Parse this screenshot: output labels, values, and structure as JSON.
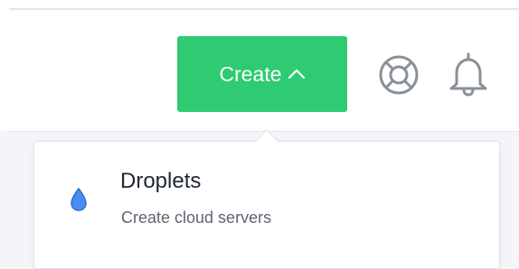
{
  "header": {
    "create_button": {
      "label": "Create",
      "color": "#2ecb72"
    },
    "icons": [
      {
        "name": "help-lifebuoy-icon"
      },
      {
        "name": "bell-icon"
      }
    ]
  },
  "create_menu": {
    "items": [
      {
        "title": "Droplets",
        "description": "Create cloud servers",
        "icon": "droplet-icon",
        "icon_color": "#4a8df0"
      }
    ]
  }
}
